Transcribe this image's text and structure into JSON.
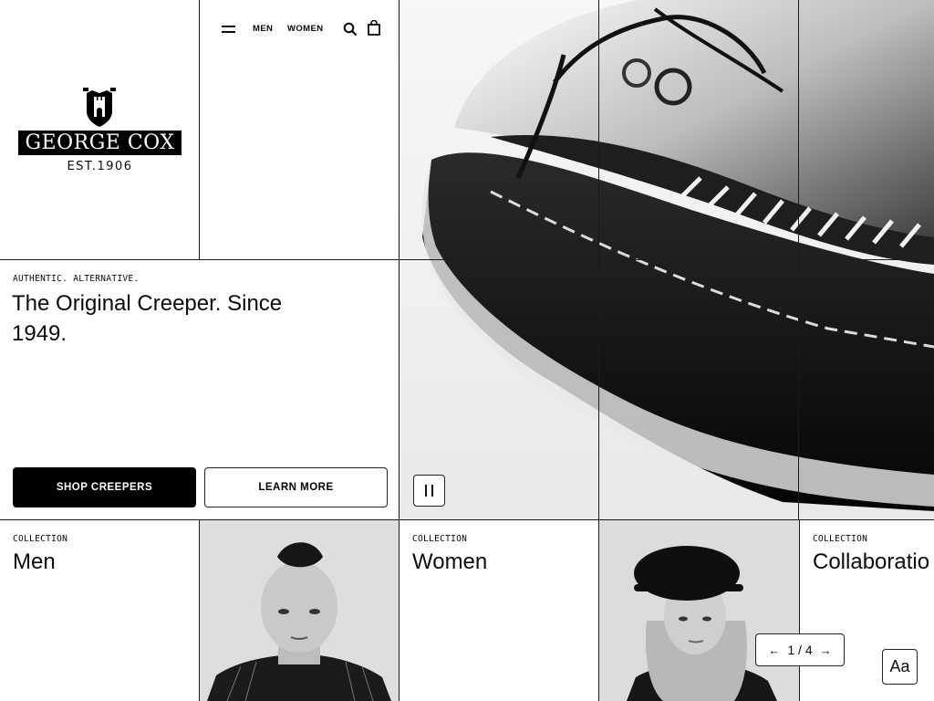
{
  "brand": {
    "name": "GEORGE COX",
    "established": "EST.1906"
  },
  "nav": {
    "men": "MEN",
    "women": "WOMEN",
    "icons": [
      "menu-icon",
      "search-icon",
      "shopping-bag-icon"
    ]
  },
  "hero": {
    "eyebrow": "AUTHENTIC. ALTERNATIVE.",
    "title": "The Original Creeper. Since 1949.",
    "primary_button": "SHOP CREEPERS",
    "secondary_button": "LEARN MORE",
    "pause_icon": "pause-icon"
  },
  "collections": [
    {
      "label": "COLLECTION",
      "title": "Men"
    },
    {
      "label": "COLLECTION",
      "title": "Women"
    },
    {
      "label": "COLLECTION",
      "title": "Collaboratio"
    }
  ],
  "carousel": {
    "position": "1 / 4",
    "prev": "←",
    "next": "→"
  },
  "accessibility": {
    "font_button": "Aa"
  },
  "colors": {
    "black": "#000000",
    "white": "#ffffff",
    "border": "#1a1a1a"
  }
}
